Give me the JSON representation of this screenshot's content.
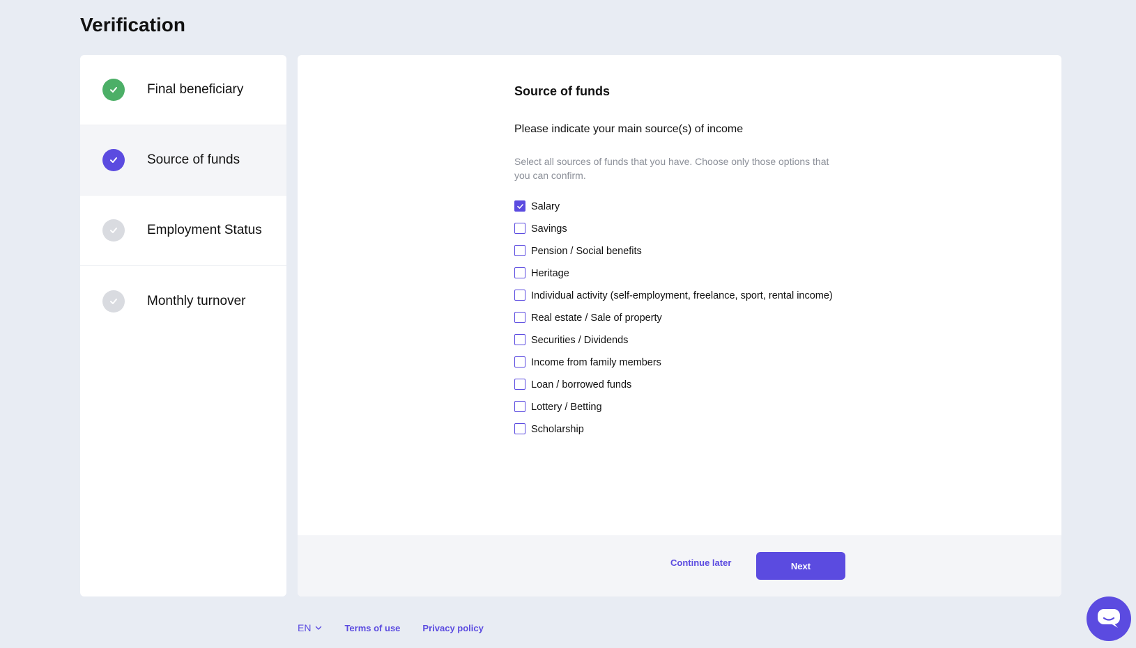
{
  "page": {
    "title": "Verification"
  },
  "sidebar": {
    "steps": [
      {
        "label": "Final beneficiary",
        "status": "completed",
        "color": "#4caf67"
      },
      {
        "label": "Source of funds",
        "status": "active",
        "color": "#5b4be0"
      },
      {
        "label": "Employment Status",
        "status": "pending",
        "color": "#d9dbe0"
      },
      {
        "label": "Monthly turnover",
        "status": "pending",
        "color": "#d9dbe0"
      }
    ]
  },
  "form": {
    "title": "Source of funds",
    "question": "Please indicate your main source(s) of income",
    "hint": "Select all sources of funds that you have. Choose only those options that you can confirm.",
    "options": [
      {
        "label": "Salary",
        "checked": true
      },
      {
        "label": "Savings",
        "checked": false
      },
      {
        "label": "Pension / Social benefits",
        "checked": false
      },
      {
        "label": "Heritage",
        "checked": false
      },
      {
        "label": "Individual activity (self-employment, freelance, sport, rental income)",
        "checked": false
      },
      {
        "label": "Real estate / Sale of property",
        "checked": false
      },
      {
        "label": "Securities / Dividends",
        "checked": false
      },
      {
        "label": "Income from family members",
        "checked": false
      },
      {
        "label": "Loan / borrowed funds",
        "checked": false
      },
      {
        "label": "Lottery / Betting",
        "checked": false
      },
      {
        "label": "Scholarship",
        "checked": false
      }
    ]
  },
  "actions": {
    "continue_later": "Continue later",
    "next": "Next"
  },
  "footer": {
    "language": "EN",
    "terms": "Terms of use",
    "privacy": "Privacy policy"
  },
  "icons": {
    "check": "check-icon",
    "chevron": "chevron-down-icon",
    "chat": "chat-icon"
  },
  "colors": {
    "accent": "#5b4be0",
    "success": "#4caf67",
    "pending": "#d9dbe0",
    "background": "#e8ecf3"
  }
}
